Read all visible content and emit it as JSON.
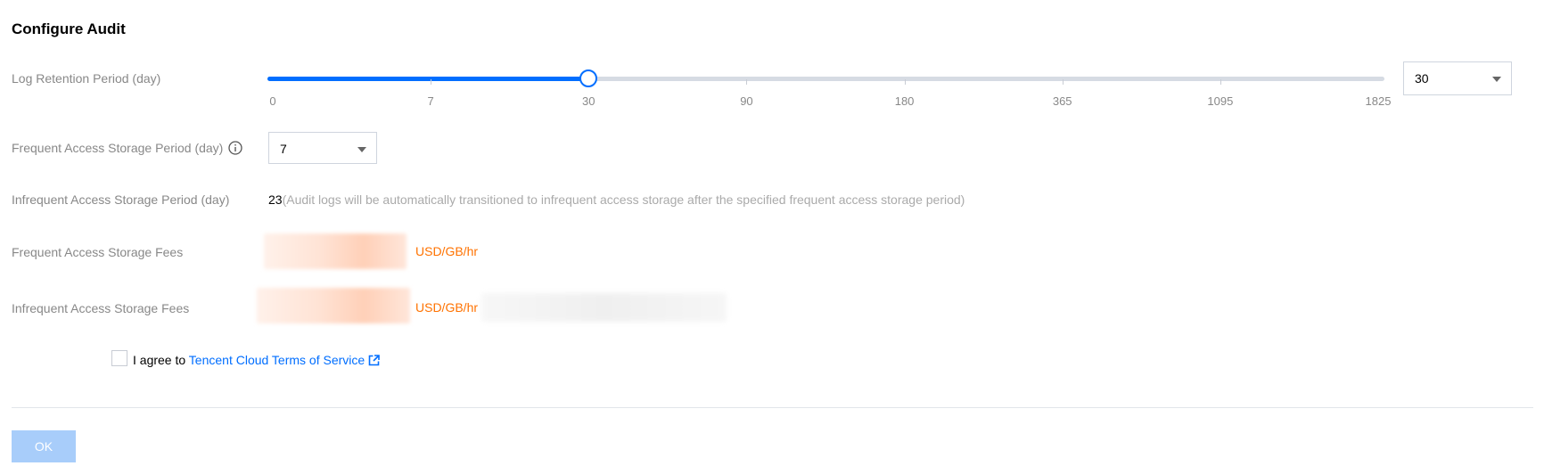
{
  "title": "Configure Audit",
  "log_retention": {
    "label": "Log Retention Period (day)",
    "ticks": [
      "0",
      "7",
      "30",
      "90",
      "180",
      "365",
      "1095",
      "1825"
    ],
    "selected_index": 2,
    "select_value": "30"
  },
  "frequent_period": {
    "label": "Frequent Access Storage Period (day)",
    "info_icon": "info-circle-icon",
    "select_value": "7"
  },
  "infrequent_period": {
    "label": "Infrequent Access Storage Period (day)",
    "value": "23",
    "hint": "(Audit logs will be automatically transitioned to infrequent access storage after the specified frequent access storage period)"
  },
  "frequent_fees": {
    "label": "Frequent Access Storage Fees",
    "unit": "USD/GB/hr"
  },
  "infrequent_fees": {
    "label": "Infrequent Access Storage Fees",
    "unit": "USD/GB/hr"
  },
  "agreement": {
    "prefix": "I agree to ",
    "link": "Tencent Cloud Terms of Service",
    "link_icon": "external-link-icon",
    "checked": false
  },
  "ok_label": "OK",
  "colors": {
    "accent": "#006eff",
    "fee_unit": "#ff7200",
    "label": "#888888",
    "ok_disabled": "#a8cdfa"
  }
}
